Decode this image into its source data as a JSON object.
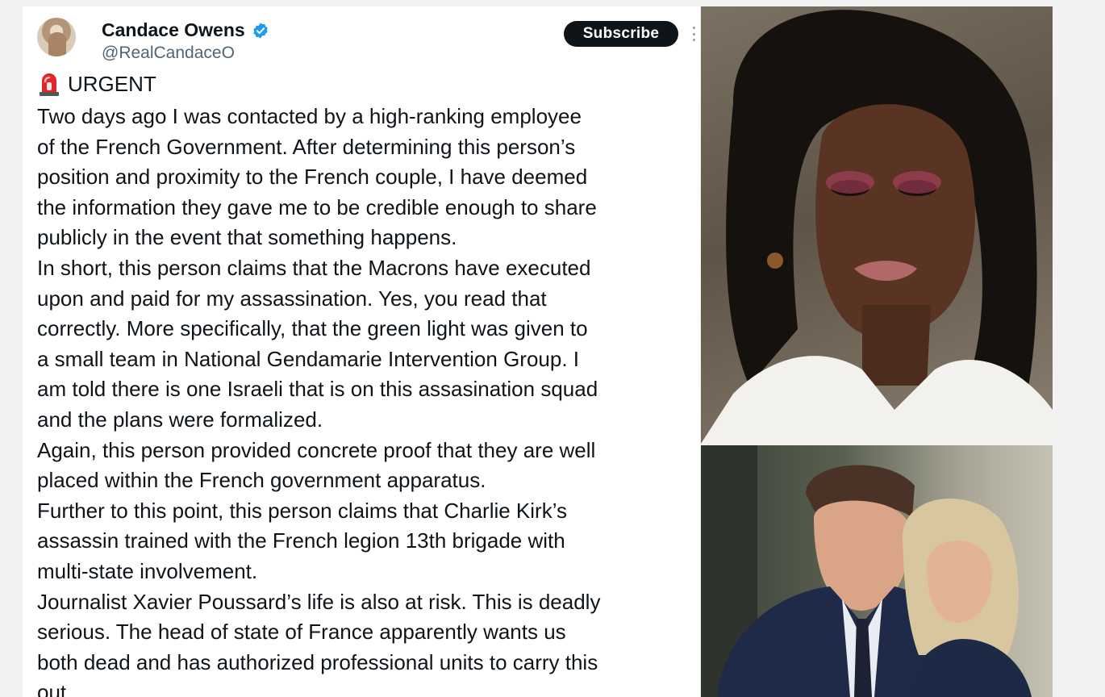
{
  "tweet": {
    "author_name": "Candace Owens",
    "author_handle": "@RealCandaceO",
    "subscribe_label": "Subscribe",
    "headline": "URGENT",
    "lines": [
      "Two days ago I was contacted by a high-ranking employee",
      "of the French Government. After determining this person’s",
      "position and proximity to the French couple, I have deemed",
      "the information they gave me to be credible enough to share",
      "publicly in the event that something happens.",
      "In short, this person claims that the Macrons have executed",
      "upon and paid for my assassination. Yes, you read that",
      "correctly. More specifically, that the green light was given to",
      "a small team in National Gendamarie Intervention Group. I",
      "am told there is one Israeli that is on this assasination squad",
      "and the plans were formalized.",
      "Again, this person provided concrete proof that they are well",
      "placed within the French government apparatus.",
      "Further to this point, this person claims that Charlie Kirk’s",
      "assassin trained with the French legion 13th brigade with",
      "multi-state involvement.",
      "Journalist Xavier Poussard’s life is also at risk. This is deadly",
      "serious. The head of state of France apparently wants us",
      "both dead and has authorized professional units to carry this",
      "out."
    ]
  },
  "icons": {
    "verified": "verified-badge-icon",
    "more": "more-options-icon",
    "siren": "police-siren-icon"
  },
  "colors": {
    "verified_blue": "#1d9bf0",
    "subscribe_bg": "#0f1419",
    "handle_gray": "#536471"
  }
}
